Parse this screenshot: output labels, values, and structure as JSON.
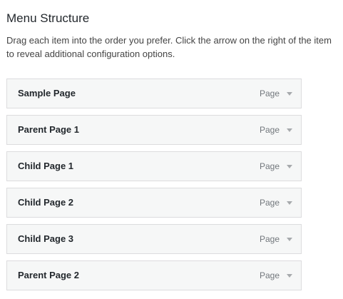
{
  "heading": "Menu Structure",
  "description": "Drag each item into the order you prefer. Click the arrow on the right of the item to reveal additional configuration options.",
  "menu_items": [
    {
      "title": "Sample Page",
      "type": "Page",
      "toggle_icon": "arrow-down-icon"
    },
    {
      "title": "Parent Page 1",
      "type": "Page",
      "toggle_icon": "arrow-down-icon"
    },
    {
      "title": "Child Page 1",
      "type": "Page",
      "toggle_icon": "arrow-down-icon"
    },
    {
      "title": "Child Page 2",
      "type": "Page",
      "toggle_icon": "arrow-down-icon"
    },
    {
      "title": "Child Page 3",
      "type": "Page",
      "toggle_icon": "arrow-down-icon"
    },
    {
      "title": "Parent Page 2",
      "type": "Page",
      "toggle_icon": "arrow-down-icon"
    }
  ],
  "colors": {
    "item_background": "#f6f7f7",
    "item_border": "#dcdcde",
    "arrow": "#a7aaad"
  }
}
